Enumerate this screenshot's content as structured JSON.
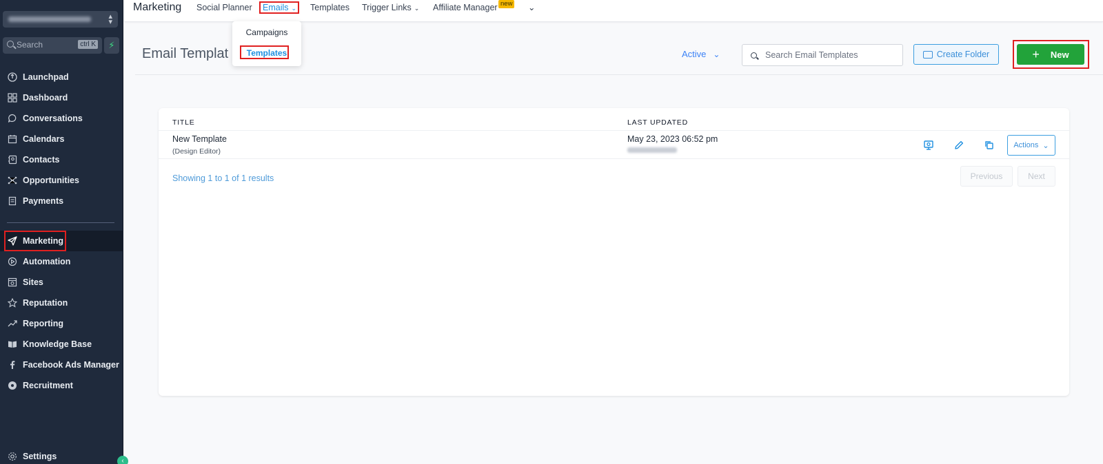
{
  "sidebar": {
    "search_placeholder": "Search",
    "search_shortcut": "ctrl K",
    "items": [
      {
        "label": "Launchpad",
        "icon": "rocket-icon"
      },
      {
        "label": "Dashboard",
        "icon": "grid-icon"
      },
      {
        "label": "Conversations",
        "icon": "chat-icon"
      },
      {
        "label": "Calendars",
        "icon": "calendar-icon"
      },
      {
        "label": "Contacts",
        "icon": "contacts-icon"
      },
      {
        "label": "Opportunities",
        "icon": "pipeline-icon"
      },
      {
        "label": "Payments",
        "icon": "receipt-icon"
      },
      {
        "label": "Marketing",
        "icon": "send-icon"
      },
      {
        "label": "Automation",
        "icon": "play-icon"
      },
      {
        "label": "Sites",
        "icon": "globe-icon"
      },
      {
        "label": "Reputation",
        "icon": "star-icon"
      },
      {
        "label": "Reporting",
        "icon": "trend-icon"
      },
      {
        "label": "Knowledge Base",
        "icon": "book-icon"
      },
      {
        "label": "Facebook Ads Manager",
        "icon": "facebook-icon"
      },
      {
        "label": "Recruitment",
        "icon": "disc-icon"
      },
      {
        "label": "Settings",
        "icon": "gear-icon"
      }
    ]
  },
  "topbar": {
    "title": "Marketing",
    "tabs": {
      "social_planner": "Social Planner",
      "emails": "Emails",
      "templates": "Templates",
      "trigger_links": "Trigger Links",
      "affiliate_manager": "Affiliate Manager",
      "new_badge": "new"
    }
  },
  "dropdown": {
    "campaigns": "Campaigns",
    "templates": "Templates"
  },
  "header": {
    "title": "Email Templat",
    "filter": "Active",
    "search_placeholder": "Search Email Templates",
    "create_folder": "Create Folder",
    "new_button": "New"
  },
  "table": {
    "columns": [
      "TITLE",
      "LAST UPDATED"
    ],
    "rows": [
      {
        "title": "New Template",
        "subtitle": "(Design Editor)",
        "updated": "May 23, 2023 06:52 pm"
      }
    ],
    "actions_label": "Actions",
    "showing": "Showing 1 to 1 of 1 results",
    "previous": "Previous",
    "next": "Next"
  },
  "colors": {
    "sidebar_bg": "#1f2a3c",
    "accent_blue": "#1d8fe0",
    "new_green": "#22a33a",
    "highlight_red": "#e02020"
  }
}
